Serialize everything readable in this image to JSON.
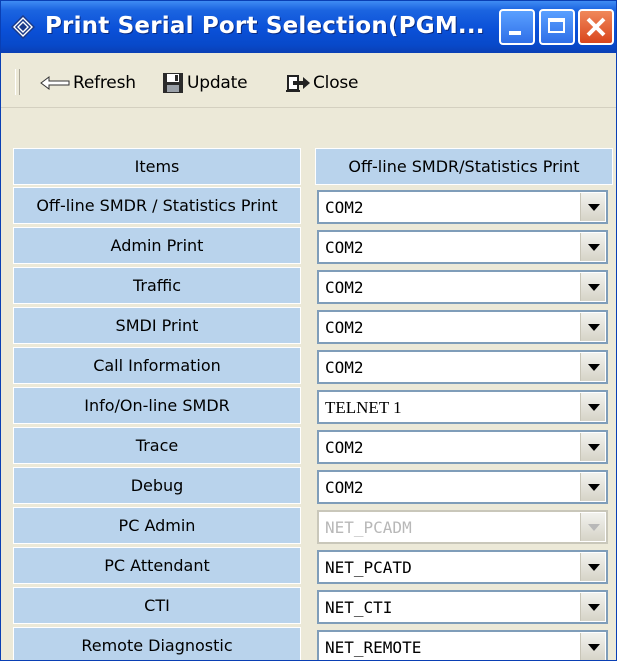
{
  "window": {
    "title": "Print Serial Port Selection(PGM..."
  },
  "toolbar": {
    "refresh_label": "Refresh",
    "update_label": "Update",
    "close_label": "Close"
  },
  "grid": {
    "col_items": "Items",
    "col_print": "Off-line SMDR/Statistics Print",
    "rows": [
      {
        "item": "Off-line SMDR / Statistics Print",
        "value": "COM2"
      },
      {
        "item": "Admin Print",
        "value": "COM2"
      },
      {
        "item": "Traffic",
        "value": "COM2"
      },
      {
        "item": "SMDI Print",
        "value": "COM2"
      },
      {
        "item": "Call Information",
        "value": "COM2"
      },
      {
        "item": "Info/On-line SMDR",
        "value": "TELNET 1"
      },
      {
        "item": "Trace",
        "value": "COM2"
      },
      {
        "item": "Debug",
        "value": "COM2"
      },
      {
        "item": "PC Admin",
        "value": "NET_PCADM",
        "disabled": true
      },
      {
        "item": "PC Attendant",
        "value": "NET_PCATD"
      },
      {
        "item": "CTI",
        "value": "NET_CTI"
      },
      {
        "item": "Remote Diagnostic",
        "value": "NET_REMOTE"
      }
    ]
  },
  "colors": {
    "titlebar": "#0a50d8",
    "item_cell": "#b9d3ec",
    "window_bg": "#ece9d8"
  }
}
